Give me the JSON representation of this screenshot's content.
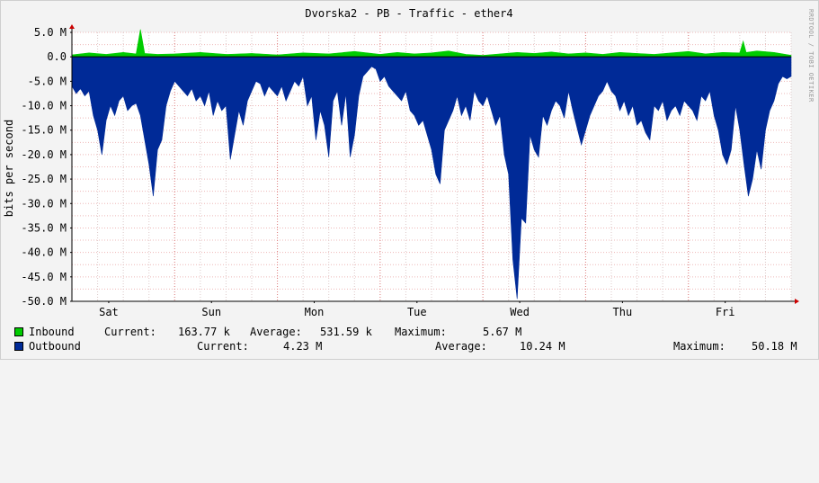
{
  "chart_data": {
    "type": "area",
    "title": "Dvorska2 - PB - Traffic - ether4",
    "ylabel": "bits per second",
    "watermark": "RRDTOOL / TOBI OETIKER",
    "ylim": [
      -50.0,
      5.0
    ],
    "yticks": [
      {
        "value": 5,
        "label": "5.0 M"
      },
      {
        "value": 0,
        "label": "0.0"
      },
      {
        "value": -5,
        "label": "-5.0 M"
      },
      {
        "value": -10,
        "label": "-10.0 M"
      },
      {
        "value": -15,
        "label": "-15.0 M"
      },
      {
        "value": -20,
        "label": "-20.0 M"
      },
      {
        "value": -25,
        "label": "-25.0 M"
      },
      {
        "value": -30,
        "label": "-30.0 M"
      },
      {
        "value": -35,
        "label": "-35.0 M"
      },
      {
        "value": -40,
        "label": "-40.0 M"
      },
      {
        "value": -45,
        "label": "-45.0 M"
      },
      {
        "value": -50,
        "label": "-50.0 M"
      }
    ],
    "xlim": [
      0,
      168
    ],
    "xticks": [
      {
        "value": 8.6,
        "label": "Sat"
      },
      {
        "value": 32.6,
        "label": "Sun"
      },
      {
        "value": 56.6,
        "label": "Mon"
      },
      {
        "value": 80.6,
        "label": "Tue"
      },
      {
        "value": 104.6,
        "label": "Wed"
      },
      {
        "value": 128.6,
        "label": "Thu"
      },
      {
        "value": 152.6,
        "label": "Fri"
      }
    ],
    "grid": true,
    "series": [
      {
        "name": "Inbound",
        "color": "#00cc00",
        "x": [
          0,
          4,
          8,
          12,
          15,
          16,
          17,
          20,
          24,
          30,
          36,
          42,
          48,
          54,
          60,
          66,
          72,
          76,
          80,
          84,
          88,
          92,
          96,
          100,
          104,
          108,
          112,
          116,
          120,
          124,
          128,
          132,
          136,
          140,
          144,
          148,
          152,
          156,
          156.8,
          157.5,
          160,
          164,
          168
        ],
        "values": [
          0.4,
          0.8,
          0.5,
          0.9,
          0.6,
          5.6,
          0.7,
          0.5,
          0.6,
          0.9,
          0.5,
          0.7,
          0.4,
          0.8,
          0.6,
          1.1,
          0.5,
          0.9,
          0.6,
          0.8,
          1.2,
          0.5,
          0.3,
          0.6,
          0.9,
          0.7,
          1.0,
          0.6,
          0.8,
          0.5,
          0.9,
          0.7,
          0.5,
          0.8,
          1.1,
          0.6,
          0.9,
          0.8,
          3.2,
          0.9,
          1.2,
          0.9,
          0.3
        ]
      },
      {
        "name": "Outbound",
        "color": "#002a97",
        "x": [
          0,
          1,
          2,
          3,
          4,
          5,
          6,
          7,
          8,
          9,
          10,
          11,
          12,
          13,
          14,
          15,
          16,
          17,
          18,
          19,
          20,
          21,
          22,
          23,
          24,
          25,
          26,
          27,
          28,
          29,
          30,
          31,
          32,
          33,
          34,
          35,
          36,
          37,
          38,
          39,
          40,
          41,
          42,
          43,
          44,
          45,
          46,
          47,
          48,
          49,
          50,
          51,
          52,
          53,
          54,
          55,
          56,
          57,
          58,
          59,
          60,
          61,
          62,
          63,
          64,
          65,
          66,
          67,
          68,
          69,
          70,
          71,
          72,
          73,
          74,
          75,
          76,
          77,
          78,
          79,
          80,
          81,
          82,
          83,
          84,
          85,
          86,
          87,
          88,
          89,
          90,
          91,
          92,
          93,
          94,
          95,
          96,
          97,
          98,
          99,
          100,
          101,
          102,
          103,
          104,
          105,
          106,
          107,
          108,
          109,
          110,
          111,
          112,
          113,
          114,
          115,
          116,
          117,
          118,
          119,
          120,
          121,
          122,
          123,
          124,
          125,
          126,
          127,
          128,
          129,
          130,
          131,
          132,
          133,
          134,
          135,
          136,
          137,
          138,
          139,
          140,
          141,
          142,
          143,
          144,
          145,
          146,
          147,
          148,
          149,
          150,
          151,
          152,
          153,
          154,
          155,
          156,
          157,
          158,
          159,
          160,
          161,
          162,
          163,
          164,
          165,
          166,
          167,
          168
        ],
        "values": [
          -6,
          -7.5,
          -6.5,
          -8,
          -7,
          -12,
          -15,
          -20,
          -13,
          -10,
          -12,
          -9,
          -8,
          -11,
          -10,
          -9.5,
          -12,
          -17,
          -22,
          -28.5,
          -19,
          -17,
          -10,
          -7,
          -5,
          -6,
          -7,
          -8,
          -6.5,
          -9,
          -8,
          -10,
          -7,
          -12,
          -9,
          -11,
          -10,
          -21,
          -16,
          -11,
          -14,
          -9,
          -7,
          -5,
          -5.5,
          -8,
          -6,
          -7,
          -8,
          -6,
          -9,
          -7,
          -5,
          -6,
          -4,
          -10,
          -8,
          -17,
          -11,
          -14,
          -20.5,
          -9,
          -7,
          -14,
          -7.5,
          -20.5,
          -16,
          -8,
          -4,
          -3,
          -2,
          -2.5,
          -5,
          -4,
          -6,
          -7,
          -8,
          -9,
          -7,
          -11,
          -12,
          -14,
          -13,
          -16,
          -19,
          -24,
          -26,
          -15,
          -13,
          -11,
          -8,
          -12,
          -10,
          -13,
          -7,
          -9,
          -10,
          -8,
          -11,
          -14,
          -12,
          -20,
          -24,
          -41.5,
          -49.5,
          -33,
          -34,
          -16,
          -19,
          -20.5,
          -12,
          -14,
          -11,
          -9,
          -10,
          -12.5,
          -7,
          -11,
          -14.5,
          -18,
          -15,
          -12,
          -10,
          -8,
          -7,
          -5,
          -7,
          -8,
          -11,
          -9,
          -12,
          -10,
          -14,
          -13,
          -15.5,
          -17,
          -10,
          -11,
          -9,
          -13,
          -11,
          -10,
          -12,
          -9,
          -10,
          -11,
          -13,
          -8,
          -9,
          -7,
          -12,
          -15,
          -20,
          -22,
          -19,
          -10,
          -15,
          -22,
          -28.5,
          -25,
          -19,
          -23,
          -15,
          -11,
          -9,
          -5.5,
          -4,
          -4.5,
          -4
        ]
      }
    ]
  },
  "legend": {
    "rows": [
      {
        "name": "Inbound",
        "color": "#00cc00",
        "current_label": "Current:",
        "current_value": "163.77 k",
        "average_label": "Average:",
        "average_value": "531.59 k",
        "maximum_label": "Maximum:",
        "maximum_value": "5.67 M"
      },
      {
        "name": "Outbound",
        "color": "#002a97",
        "current_label": "Current:",
        "current_value": "4.23 M",
        "average_label": "Average:",
        "average_value": "10.24 M",
        "maximum_label": "Maximum:",
        "maximum_value": "50.18 M"
      }
    ]
  }
}
